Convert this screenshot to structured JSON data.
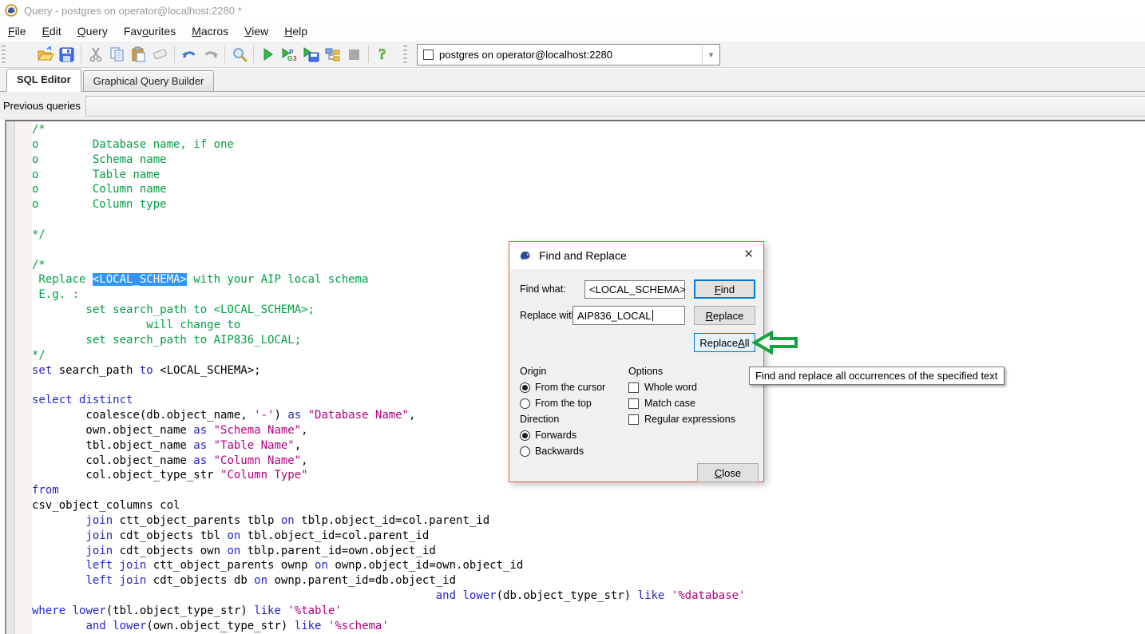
{
  "window": {
    "title": "Query - postgres on operator@localhost:2280 *"
  },
  "menu": {
    "items": [
      {
        "label": "File",
        "accel": 0
      },
      {
        "label": "Edit",
        "accel": 0
      },
      {
        "label": "Query",
        "accel": 0
      },
      {
        "label": "Favourites",
        "accel": 3
      },
      {
        "label": "Macros",
        "accel": 0
      },
      {
        "label": "View",
        "accel": 0
      },
      {
        "label": "Help",
        "accel": 0
      }
    ]
  },
  "toolbar": {
    "icons": [
      "open-file-icon",
      "save-icon",
      "cut-icon",
      "copy-icon",
      "paste-icon",
      "clear-window-icon",
      "undo-icon",
      "redo-icon",
      "find-icon",
      "execute-query-icon",
      "execute-pgscript-icon",
      "execute-to-file-icon",
      "explain-query-icon",
      "cancel-query-icon",
      "help-icon"
    ],
    "connection": {
      "value": "postgres on operator@localhost:2280"
    }
  },
  "tabs": [
    {
      "label": "SQL Editor",
      "active": true
    },
    {
      "label": "Graphical Query Builder",
      "active": false
    }
  ],
  "previous_queries": {
    "label": "Previous queries",
    "value": ""
  },
  "editor": {
    "lines": [
      [
        [
          "/*",
          "c"
        ]
      ],
      [
        [
          "o        Database name, if one",
          "c"
        ]
      ],
      [
        [
          "o        Schema name",
          "c"
        ]
      ],
      [
        [
          "o        Table name",
          "c"
        ]
      ],
      [
        [
          "o        Column name",
          "c"
        ]
      ],
      [
        [
          "o        Column type",
          "c"
        ]
      ],
      [],
      [
        [
          "*/",
          "c"
        ]
      ],
      [],
      [
        [
          "/*",
          "c"
        ]
      ],
      [
        [
          " Replace ",
          "c"
        ],
        [
          "<LOCAL_SCHEMA>",
          "sel"
        ],
        [
          " with your AIP local schema",
          "c"
        ]
      ],
      [
        [
          " E.g. :",
          "c"
        ]
      ],
      [
        [
          "        set search_path to <LOCAL_SCHEMA>;",
          "c"
        ]
      ],
      [
        [
          "                 will change to",
          "c"
        ]
      ],
      [
        [
          "        set search_path to AIP836_LOCAL;",
          "c"
        ]
      ],
      [
        [
          "*/",
          "c"
        ]
      ],
      [
        [
          "set",
          "k"
        ],
        [
          " search_path ",
          "p"
        ],
        [
          "to",
          "k"
        ],
        [
          " <LOCAL_SCHEMA>;",
          "p"
        ]
      ],
      [],
      [
        [
          "select",
          "k"
        ],
        [
          " ",
          "p"
        ],
        [
          "distinct",
          "k"
        ]
      ],
      [
        [
          "        coalesce(db.object_name, ",
          "p"
        ],
        [
          "'-'",
          "s"
        ],
        [
          ") ",
          "p"
        ],
        [
          "as",
          "k"
        ],
        [
          " ",
          "p"
        ],
        [
          "\"Database Name\"",
          "s"
        ],
        [
          ",",
          "p"
        ]
      ],
      [
        [
          "        own.object_name ",
          "p"
        ],
        [
          "as",
          "k"
        ],
        [
          " ",
          "p"
        ],
        [
          "\"Schema Name\"",
          "s"
        ],
        [
          ",",
          "p"
        ]
      ],
      [
        [
          "        tbl.object_name ",
          "p"
        ],
        [
          "as",
          "k"
        ],
        [
          " ",
          "p"
        ],
        [
          "\"Table Name\"",
          "s"
        ],
        [
          ",",
          "p"
        ]
      ],
      [
        [
          "        col.object_name ",
          "p"
        ],
        [
          "as",
          "k"
        ],
        [
          " ",
          "p"
        ],
        [
          "\"Column Name\"",
          "s"
        ],
        [
          ",",
          "p"
        ]
      ],
      [
        [
          "        col.object_type_str ",
          "p"
        ],
        [
          "\"Column Type\"",
          "s"
        ]
      ],
      [
        [
          "from",
          "k"
        ]
      ],
      [
        [
          "csv_object_columns col",
          "p"
        ]
      ],
      [
        [
          "        ",
          "p"
        ],
        [
          "join",
          "k"
        ],
        [
          " ctt_object_parents tblp ",
          "p"
        ],
        [
          "on",
          "k"
        ],
        [
          " tblp.object_id=col.parent_id",
          "p"
        ]
      ],
      [
        [
          "        ",
          "p"
        ],
        [
          "join",
          "k"
        ],
        [
          " cdt_objects tbl ",
          "p"
        ],
        [
          "on",
          "k"
        ],
        [
          " tbl.object_id=col.parent_id",
          "p"
        ]
      ],
      [
        [
          "        ",
          "p"
        ],
        [
          "join",
          "k"
        ],
        [
          " cdt_objects own ",
          "p"
        ],
        [
          "on",
          "k"
        ],
        [
          " tblp.parent_id=own.object_id",
          "p"
        ]
      ],
      [
        [
          "        ",
          "p"
        ],
        [
          "left",
          "k"
        ],
        [
          " ",
          "p"
        ],
        [
          "join",
          "k"
        ],
        [
          " ctt_object_parents ownp ",
          "p"
        ],
        [
          "on",
          "k"
        ],
        [
          " ownp.object_id=own.object_id",
          "p"
        ]
      ],
      [
        [
          "        ",
          "p"
        ],
        [
          "left",
          "k"
        ],
        [
          " ",
          "p"
        ],
        [
          "join",
          "k"
        ],
        [
          " cdt_objects db ",
          "p"
        ],
        [
          "on",
          "k"
        ],
        [
          " ownp.parent_id=db.object_id",
          "p"
        ]
      ],
      [
        [
          "                                                            ",
          "p"
        ],
        [
          "and",
          "k"
        ],
        [
          " ",
          "p"
        ],
        [
          "lower",
          "k"
        ],
        [
          "(db.object_type_str) ",
          "p"
        ],
        [
          "like",
          "k"
        ],
        [
          " ",
          "p"
        ],
        [
          "'%database'",
          "s"
        ]
      ],
      [
        [
          "where",
          "k"
        ],
        [
          " ",
          "p"
        ],
        [
          "lower",
          "k"
        ],
        [
          "(tbl.object_type_str) ",
          "p"
        ],
        [
          "like",
          "k"
        ],
        [
          " ",
          "p"
        ],
        [
          "'%table'",
          "s"
        ]
      ],
      [
        [
          "        ",
          "p"
        ],
        [
          "and",
          "k"
        ],
        [
          " ",
          "p"
        ],
        [
          "lower",
          "k"
        ],
        [
          "(own.object_type_str) ",
          "p"
        ],
        [
          "like",
          "k"
        ],
        [
          " ",
          "p"
        ],
        [
          "'%schema'",
          "s"
        ]
      ]
    ]
  },
  "dialog": {
    "title": "Find and Replace",
    "find_label": "Find what:",
    "find_value": "<LOCAL_SCHEMA>",
    "replace_label": "Replace with:",
    "replace_value": "AIP836_LOCAL",
    "buttons": {
      "find": {
        "label": "Find",
        "accel": 0
      },
      "replace": {
        "label": "Replace",
        "accel": 0
      },
      "replace_all": {
        "label": "Replace All",
        "accel": 8
      },
      "close": {
        "label": "Close",
        "accel": 0
      }
    },
    "origin": {
      "label": "Origin",
      "options": [
        {
          "label": "From the cursor",
          "selected": true
        },
        {
          "label": "From the top",
          "selected": false
        }
      ]
    },
    "direction": {
      "label": "Direction",
      "options": [
        {
          "label": "Forwards",
          "selected": true
        },
        {
          "label": "Backwards",
          "selected": false
        }
      ]
    },
    "options": {
      "label": "Options",
      "checks": [
        {
          "label": "Whole word",
          "checked": false
        },
        {
          "label": "Match case",
          "checked": false
        },
        {
          "label": "Regular expressions",
          "checked": false
        }
      ]
    }
  },
  "tooltip": {
    "text": "Find and replace all occurrences of the specified text"
  },
  "colors": {
    "keyword": "#2424cc",
    "comment": "#00a044",
    "string": "#b00080",
    "selection_bg": "#3096fa",
    "dialog_border": "#e0614f",
    "focus_blue": "#0078d7",
    "arrow_green": "#17a23b"
  }
}
